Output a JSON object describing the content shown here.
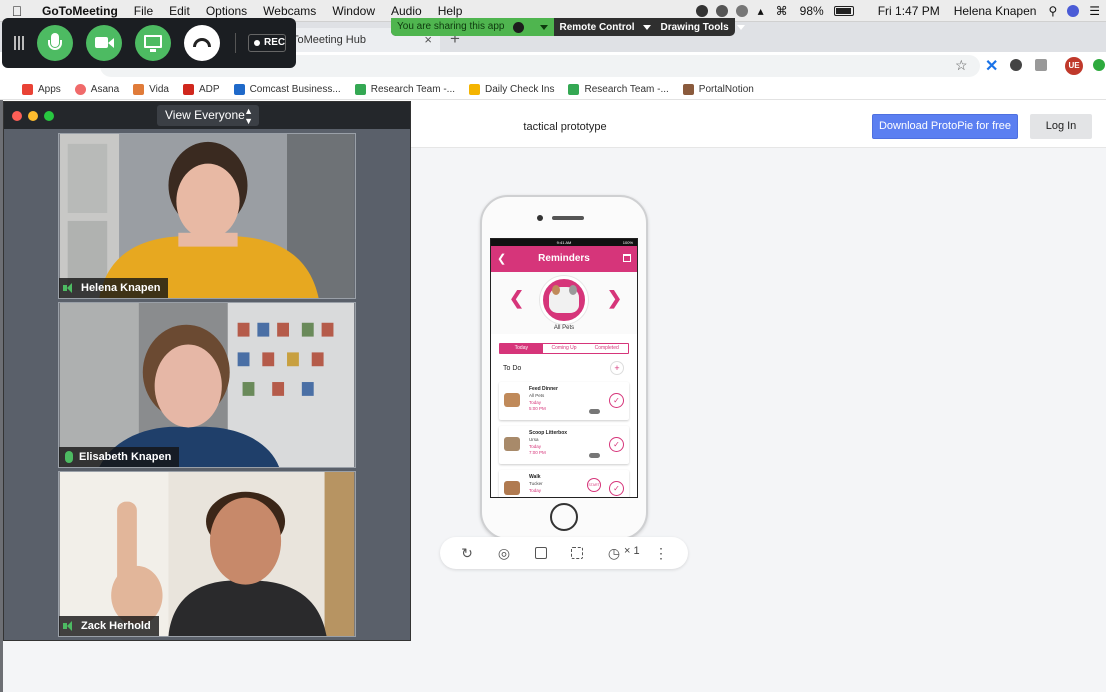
{
  "menubar": {
    "app": "GoToMeeting",
    "items": [
      "File",
      "Edit",
      "Options",
      "Webcams",
      "Window",
      "Audio",
      "Help"
    ],
    "battery": "98%",
    "clock": "Fri 1:47 PM",
    "user": "Helena Knapen"
  },
  "share_bar": {
    "status": "You are sharing this app",
    "remote_control": "Remote Control",
    "drawing_tools": "Drawing Tools"
  },
  "gtm_controls": {
    "rec_label": "REC",
    "accent": "#4dbb62"
  },
  "browser": {
    "tab_title": "ToMeeting Hub",
    "bookmarks": [
      {
        "label": "Apps",
        "color": "#e94235"
      },
      {
        "label": "Asana",
        "color": "#f06a6a"
      },
      {
        "label": "Vida",
        "color": "#e07b39"
      },
      {
        "label": "ADP",
        "color": "#d0271d"
      },
      {
        "label": "Comcast Business...",
        "color": "#1f69c9"
      },
      {
        "label": "Research Team -...",
        "color": "#34a853"
      },
      {
        "label": "Daily Check Ins",
        "color": "#f4b400"
      },
      {
        "label": "Research Team -...",
        "color": "#34a853"
      },
      {
        "label": "PortalNotion",
        "color": "#8a5a3c"
      }
    ],
    "avatar_initials": "UE"
  },
  "page": {
    "title": "tactical prototype",
    "download_button": "Download ProtoPie for free",
    "login_button": "Log In"
  },
  "phone_app": {
    "status_time": "9:41 AM",
    "status_battery": "100%",
    "header_title": "Reminders",
    "pet_label": "All Pets",
    "tabs": [
      "Today",
      "Coming Up",
      "Completed"
    ],
    "section_title": "To Do",
    "tasks": [
      {
        "name": "Feed Dinner",
        "pet": "All Pets",
        "when": "Today",
        "time": "5:00 PM"
      },
      {
        "name": "Scoop Litterbox",
        "pet": "Ursa",
        "when": "Today",
        "time": "7:00 PM"
      },
      {
        "name": "Walk",
        "pet": "Tucker",
        "when": "Today",
        "start": "START"
      }
    ],
    "brand_color": "#d6357a"
  },
  "bottom_toolbar": {
    "speed": "× 1"
  },
  "video_window": {
    "view_selector": "View Everyone",
    "participants": [
      {
        "name": "Helena Knapen"
      },
      {
        "name": "Elisabeth Knapen"
      },
      {
        "name": "Zack Herhold"
      }
    ]
  }
}
